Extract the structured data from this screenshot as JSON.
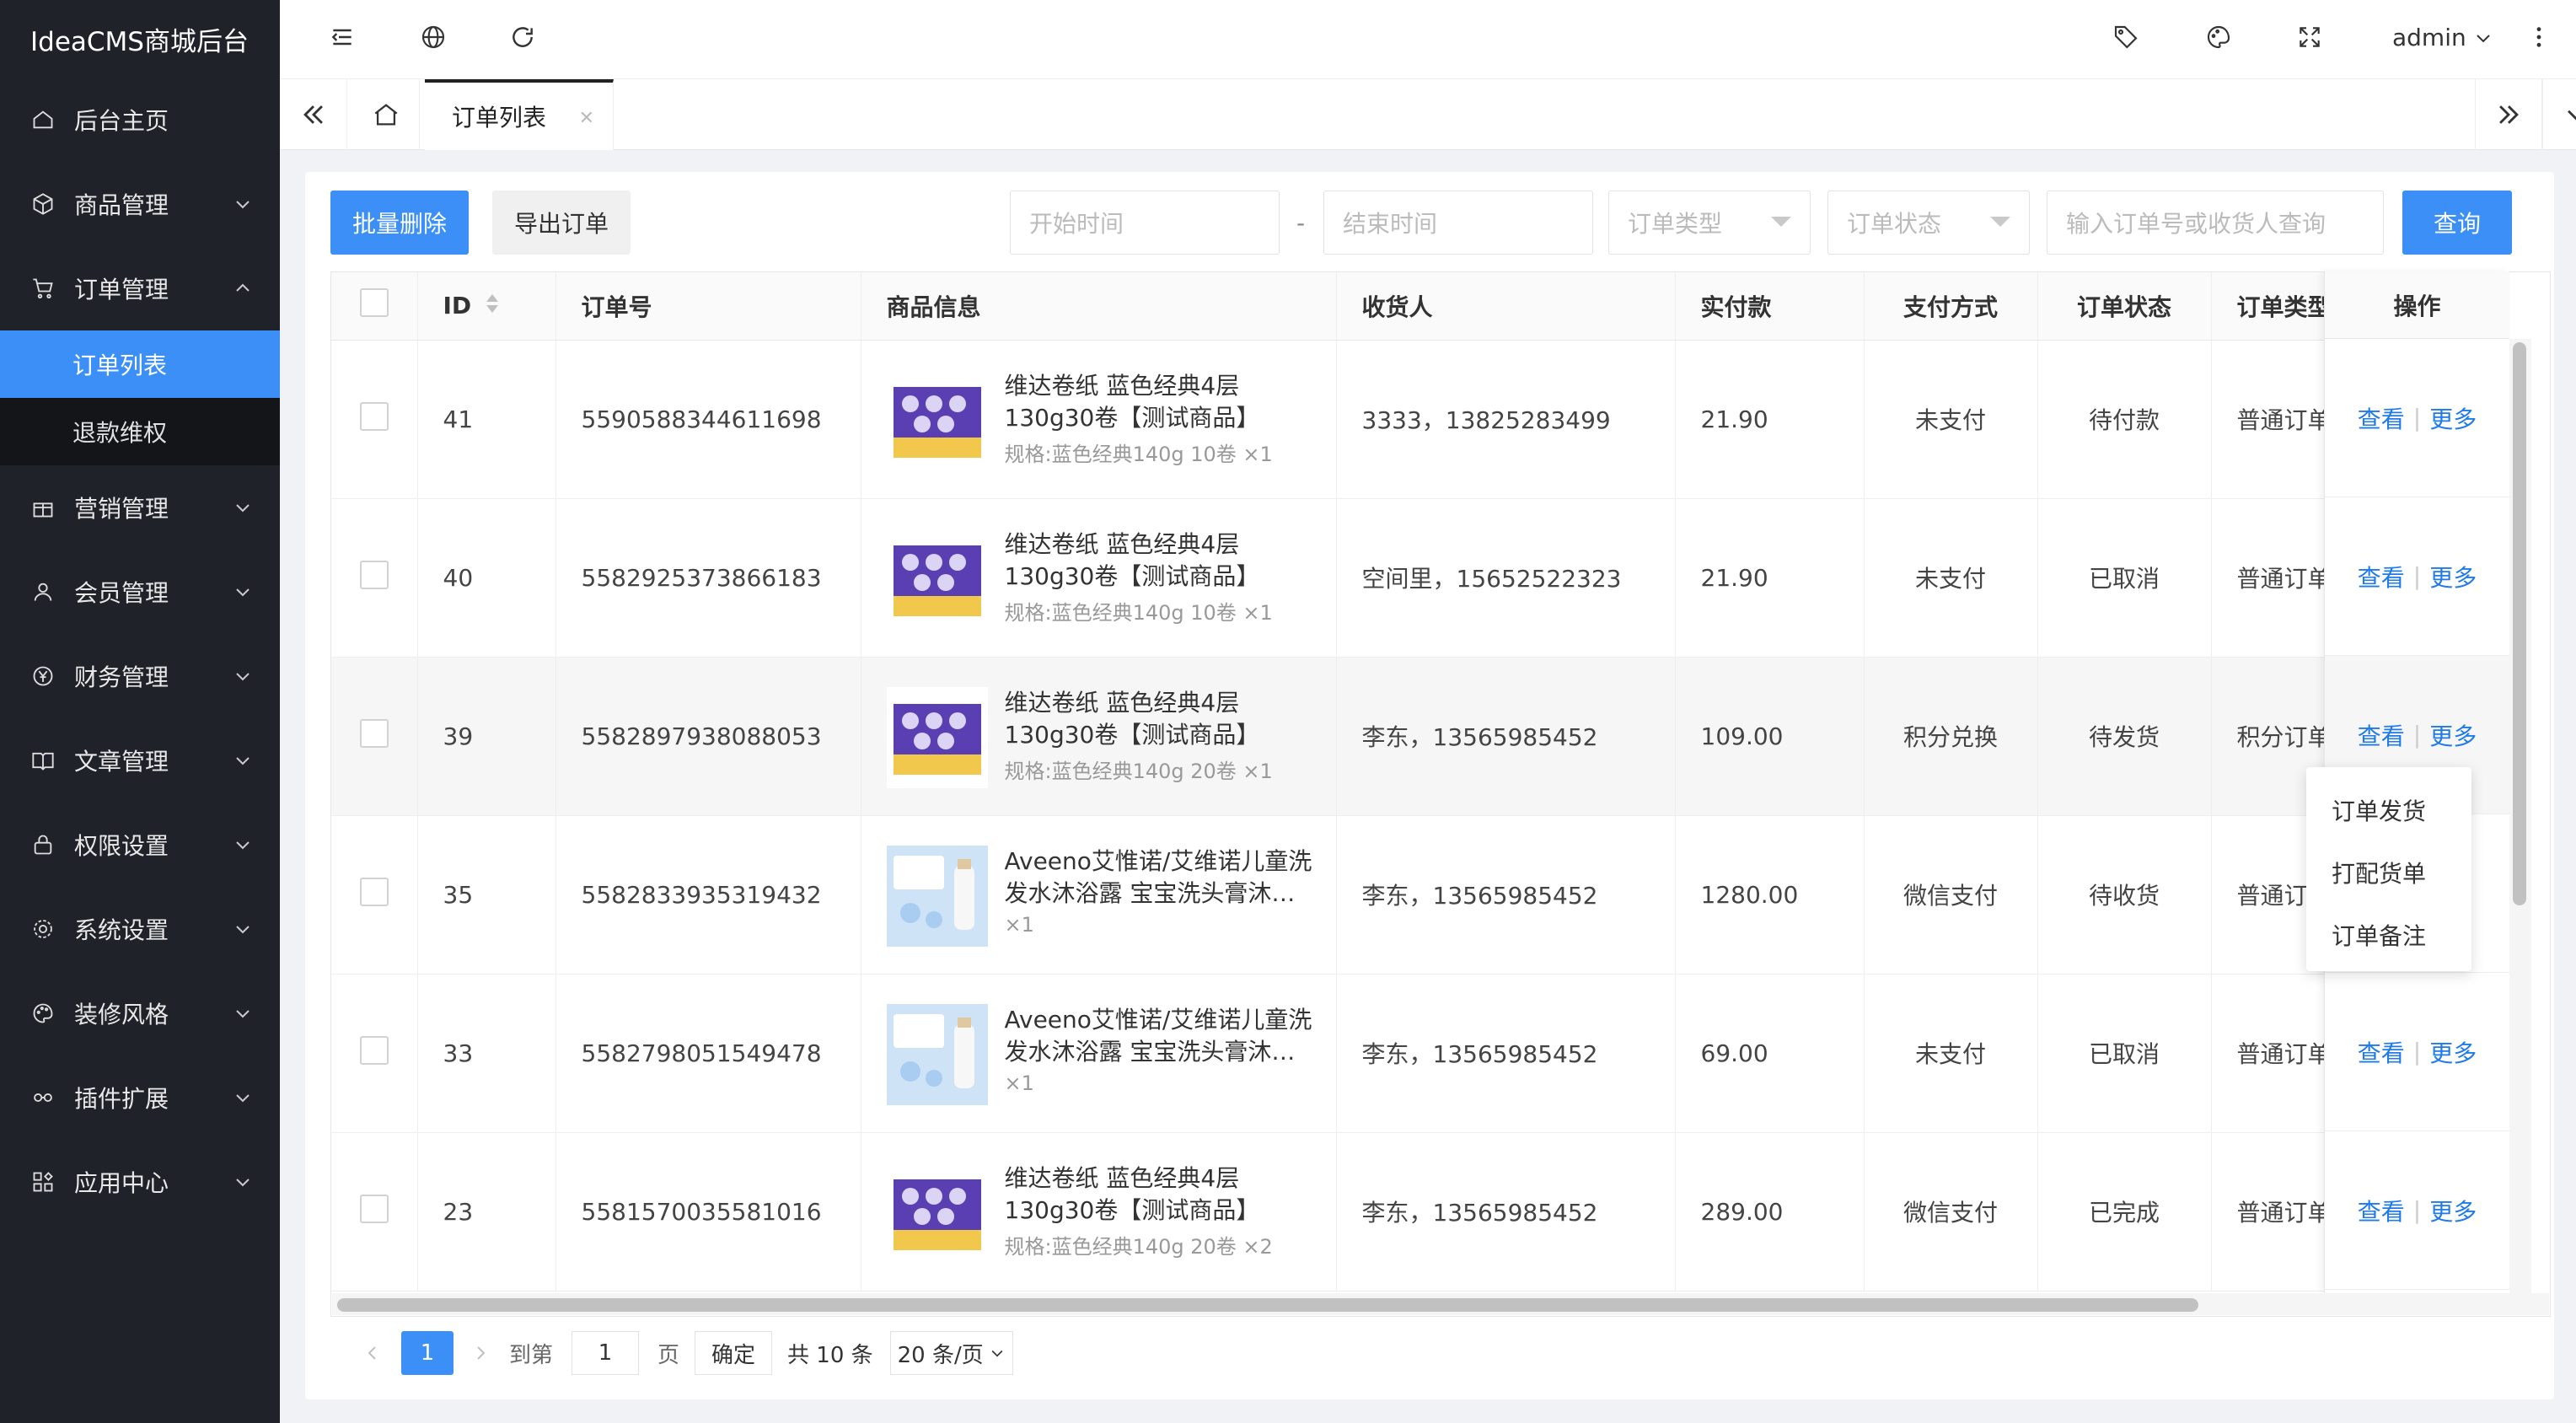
{
  "app": {
    "title": "IdeaCMS商城后台"
  },
  "header": {
    "user": "admin"
  },
  "sidebar": {
    "items": [
      {
        "label": "后台主页",
        "icon": "home-icon"
      },
      {
        "label": "商品管理",
        "icon": "box-icon"
      },
      {
        "label": "订单管理",
        "icon": "cart-icon"
      },
      {
        "label": "营销管理",
        "icon": "gift-icon"
      },
      {
        "label": "会员管理",
        "icon": "user-icon"
      },
      {
        "label": "财务管理",
        "icon": "yen-icon"
      },
      {
        "label": "文章管理",
        "icon": "book-icon"
      },
      {
        "label": "权限设置",
        "icon": "lock-icon"
      },
      {
        "label": "系统设置",
        "icon": "gear-icon"
      },
      {
        "label": "装修风格",
        "icon": "palette-icon"
      },
      {
        "label": "插件扩展",
        "icon": "link-icon"
      },
      {
        "label": "应用中心",
        "icon": "apps-icon"
      }
    ],
    "sub": [
      "订单列表",
      "退款维权"
    ]
  },
  "tabs": {
    "active": "订单列表"
  },
  "toolbar": {
    "batch_delete": "批量删除",
    "export": "导出订单",
    "start_time": "开始时间",
    "dash": "-",
    "end_time": "结束时间",
    "order_type": "订单类型",
    "order_status": "订单状态",
    "search_placeholder": "输入订单号或收货人查询",
    "query": "查询"
  },
  "table": {
    "headers": [
      "ID",
      "订单号",
      "商品信息",
      "收货人",
      "实付款",
      "支付方式",
      "订单状态",
      "订单类型",
      "操作"
    ],
    "rows": [
      {
        "id": "41",
        "order_no": "5590588344611698",
        "goods": "维达卷纸 蓝色经典4层130g30卷【测试商品】",
        "spec": "规格:蓝色经典140g 10卷 ×1",
        "receiver": "3333，13825283499",
        "amount": "21.90",
        "pay": "未支付",
        "status": "待付款",
        "type": "普通订单"
      },
      {
        "id": "40",
        "order_no": "5582925373866183",
        "goods": "维达卷纸 蓝色经典4层130g30卷【测试商品】",
        "spec": "规格:蓝色经典140g 10卷 ×1",
        "receiver": "空间里，15652522323",
        "amount": "21.90",
        "pay": "未支付",
        "status": "已取消",
        "type": "普通订单"
      },
      {
        "id": "39",
        "order_no": "5582897938088053",
        "goods": "维达卷纸 蓝色经典4层130g30卷【测试商品】",
        "spec": "规格:蓝色经典140g 20卷 ×1",
        "receiver": "李东，13565985452",
        "amount": "109.00",
        "pay": "积分兑换",
        "status": "待发货",
        "type": "积分订单"
      },
      {
        "id": "35",
        "order_no": "5582833935319432",
        "goods": "Aveeno艾惟诺/艾维诺儿童洗发水沐浴露 宝宝洗头膏沐…",
        "spec": "×1",
        "receiver": "李东，13565985452",
        "amount": "1280.00",
        "pay": "微信支付",
        "status": "待收货",
        "type": "普通订单"
      },
      {
        "id": "33",
        "order_no": "5582798051549478",
        "goods": "Aveeno艾惟诺/艾维诺儿童洗发水沐浴露 宝宝洗头膏沐…",
        "spec": "×1",
        "receiver": "李东，13565985452",
        "amount": "69.00",
        "pay": "未支付",
        "status": "已取消",
        "type": "普通订单"
      },
      {
        "id": "23",
        "order_no": "5581570035581016",
        "goods": "维达卷纸 蓝色经典4层130g30卷【测试商品】",
        "spec": "规格:蓝色经典140g 20卷 ×2",
        "receiver": "李东，13565985452",
        "amount": "289.00",
        "pay": "微信支付",
        "status": "已完成",
        "type": "普通订单"
      }
    ],
    "view": "查看",
    "more": "更多",
    "sep": "|"
  },
  "dropdown": [
    "订单发货",
    "打配货单",
    "订单备注"
  ],
  "pager": {
    "current": "1",
    "goto": "到第",
    "page_input": "1",
    "page_unit": "页",
    "confirm": "确定",
    "total": "共 10 条",
    "size": "20 条/页"
  },
  "colors": {
    "primary": "#3b8ff6",
    "sidebar": "#20222a",
    "link": "#1e7be9"
  }
}
